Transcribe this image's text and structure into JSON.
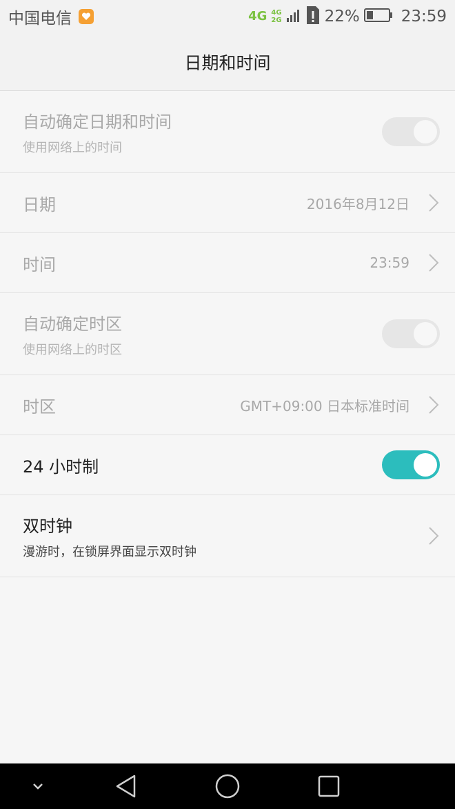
{
  "status_bar": {
    "carrier": "中国电信",
    "network_primary": "4G",
    "network_secondary_top": "4G",
    "network_secondary_bottom": "2G",
    "battery_percent": "22%",
    "time": "23:59"
  },
  "header": {
    "title": "日期和时间"
  },
  "settings": {
    "auto_datetime": {
      "title": "自动确定日期和时间",
      "subtitle": "使用网络上的时间",
      "enabled": false,
      "checked": true
    },
    "date": {
      "title": "日期",
      "value": "2016年8月12日"
    },
    "time": {
      "title": "时间",
      "value": "23:59"
    },
    "auto_timezone": {
      "title": "自动确定时区",
      "subtitle": "使用网络上的时区",
      "enabled": false,
      "checked": true
    },
    "timezone": {
      "title": "时区",
      "value": "GMT+09:00 日本标准时间"
    },
    "hour24": {
      "title": "24 小时制",
      "checked": true
    },
    "dual_clock": {
      "title": "双时钟",
      "subtitle": "漫游时，在锁屏界面显示双时钟"
    }
  },
  "colors": {
    "accent": "#2cbdbd",
    "disabled_text": "#a9a9a9",
    "background": "#f6f6f6"
  },
  "icons": {
    "notification": "heart-notification-icon",
    "signal": "signal-bars-icon",
    "sim": "sim-alert-icon",
    "battery": "battery-icon",
    "chevron": "chevron-right-icon",
    "nav_down": "chevron-down-icon",
    "nav_back": "back-triangle-icon",
    "nav_home": "home-circle-icon",
    "nav_recent": "recent-square-icon"
  }
}
